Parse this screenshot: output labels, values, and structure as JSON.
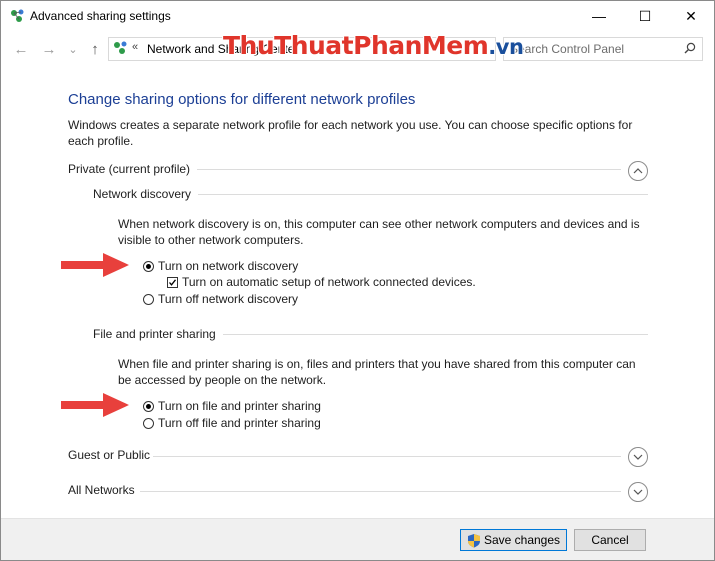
{
  "window": {
    "title": "Advanced sharing settings",
    "minimize_glyph": "—",
    "maximize_glyph": "☐",
    "close_glyph": "✕"
  },
  "nav": {
    "back_glyph": "←",
    "forward_glyph": "→",
    "recent_glyph": "⌄",
    "up_glyph": "↑"
  },
  "address": {
    "separator": "«",
    "path": "Network and Sharing Center",
    "icon": "network-icon"
  },
  "search": {
    "placeholder": "Search Control Panel",
    "icon": "search-icon"
  },
  "watermark": {
    "main": "ThuThuatPhanMem",
    "suffix": ".vn"
  },
  "content": {
    "heading": "Change sharing options for different network profiles",
    "description": "Windows creates a separate network profile for each network you use. You can choose specific options for each profile.",
    "private": {
      "label": "Private (current profile)",
      "network_discovery": {
        "label": "Network discovery",
        "description": "When network discovery is on, this computer can see other network computers and devices and is visible to other network computers.",
        "on_label": "Turn on network discovery",
        "auto_setup_label": "Turn on automatic setup of network connected devices.",
        "off_label": "Turn off network discovery"
      },
      "file_printer": {
        "label": "File and printer sharing",
        "description": "When file and printer sharing is on, files and printers that you have shared from this computer can be accessed by people on the network.",
        "on_label": "Turn on file and printer sharing",
        "off_label": "Turn off file and printer sharing"
      }
    },
    "guest_public_label": "Guest or Public",
    "all_networks_label": "All Networks"
  },
  "footer": {
    "save_label": "Save changes",
    "cancel_label": "Cancel"
  },
  "colors": {
    "heading": "#1c3f95",
    "watermark_red": "#e0352b",
    "watermark_blue": "#1a4f9c",
    "arrow_red": "#e8403c",
    "focus_blue": "#0078d7"
  }
}
